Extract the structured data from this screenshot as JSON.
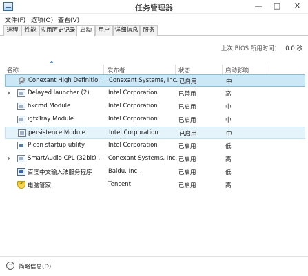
{
  "window": {
    "title": "任务管理器",
    "minimize_glyph": "—",
    "maximize_glyph": "□",
    "close_glyph": "✕"
  },
  "menu": [
    "文件(F)",
    "选项(O)",
    "查看(V)"
  ],
  "tabs": [
    "进程",
    "性能",
    "应用历史记录",
    "启动",
    "用户",
    "详细信息",
    "服务"
  ],
  "active_tab": "启动",
  "bios": {
    "label": "上次 BIOS 所用时间：",
    "value": "0.0 秒"
  },
  "columns": {
    "name": "名称",
    "publisher": "发布者",
    "status": "状态",
    "impact": "启动影响"
  },
  "rows": [
    {
      "icon": "wrench-icon",
      "name": "Conexant High Definition ...",
      "publisher": "Conexant Systems, Inc.",
      "status": "已启用",
      "impact": "中",
      "expandable": false
    },
    {
      "icon": "window-icon",
      "name": "Delayed launcher (2)",
      "publisher": "Intel Corporation",
      "status": "已禁用",
      "impact": "高",
      "expandable": true
    },
    {
      "icon": "window-icon",
      "name": "hkcmd Module",
      "publisher": "Intel Corporation",
      "status": "已启用",
      "impact": "中",
      "expandable": false
    },
    {
      "icon": "window-icon",
      "name": "igfxTray Module",
      "publisher": "Intel Corporation",
      "status": "已启用",
      "impact": "中",
      "expandable": false
    },
    {
      "icon": "window-icon",
      "name": "persistence Module",
      "publisher": "Intel Corporation",
      "status": "已启用",
      "impact": "中",
      "expandable": false
    },
    {
      "icon": "monitor-icon",
      "name": "PIcon startup utility",
      "publisher": "Intel Corporation",
      "status": "已启用",
      "impact": "低",
      "expandable": false
    },
    {
      "icon": "window-icon",
      "name": "SmartAudio CPL (32bit) (2)",
      "publisher": "Conexant Systems, Inc.",
      "status": "已启用",
      "impact": "高",
      "expandable": true
    },
    {
      "icon": "baidu-ime-icon",
      "name": "百度中文输入法服务程序",
      "publisher": "Baidu, Inc.",
      "status": "已启用",
      "impact": "低",
      "expandable": false
    },
    {
      "icon": "shield-icon",
      "name": "电脑管家",
      "publisher": "Tencent",
      "status": "已启用",
      "impact": "高",
      "expandable": false
    }
  ],
  "footer": {
    "label": "简略信息(D)",
    "chevron_glyph": "⌃"
  }
}
